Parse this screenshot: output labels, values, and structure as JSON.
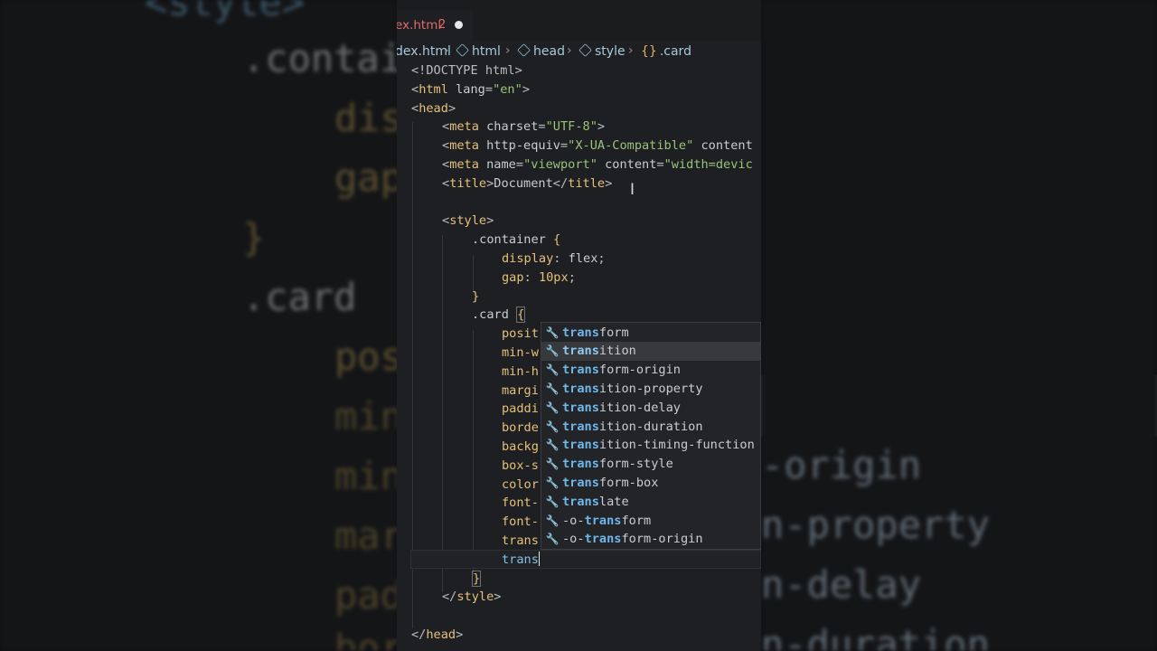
{
  "background": {
    "left_lines": [
      "<style>",
      ".contai",
      "dis",
      "gap",
      "}",
      ".card",
      "pos",
      "min",
      "min",
      "mar",
      "pad",
      "bor"
    ],
    "right_lines": [
      "-origin",
      "n-property",
      "n-delay",
      "n-duration"
    ]
  },
  "tab": {
    "name": "ex.html",
    "problems": "2"
  },
  "breadcrumb": {
    "file": "dex.html",
    "items": [
      "html",
      "head",
      "style",
      ".card"
    ]
  },
  "code": {
    "l1": [
      "<!DOCTYPE html>"
    ],
    "l2_tag": "html",
    "l2_attr": "lang",
    "l2_val": "\"en\"",
    "l3_tag": "head",
    "l4_tag": "meta",
    "l4_attr": "charset",
    "l4_val": "\"UTF-8\"",
    "l5_tag": "meta",
    "l5_attr": "http-equiv",
    "l5_val": "\"X-UA-Compatible\"",
    "l5_rest": "content",
    "l6_tag": "meta",
    "l6_attr": "name",
    "l6_val": "\"viewport\"",
    "l6_attr2": "content",
    "l6_val2": "\"width=devic",
    "l7_tag": "title",
    "l7_text": "Document",
    "l7_endtag": "title",
    "l9_tag": "style",
    "l10_sel": ".container",
    "l11_prop": "display",
    "l11_val": "flex",
    "l12_prop": "gap",
    "l12_val": "10px",
    "l14_sel": ".card",
    "partials": [
      "posit",
      "min-w",
      "min-h",
      "margi",
      "paddi",
      "borde",
      "backg",
      "box-s",
      "color",
      "font-",
      "font-",
      "trans"
    ],
    "typed": "trans",
    "end_style": "style",
    "end_head": "head"
  },
  "suggestions": {
    "items": [
      {
        "match": "trans",
        "rest": "form"
      },
      {
        "match": "trans",
        "rest": "ition",
        "selected": true
      },
      {
        "match": "trans",
        "rest": "form-origin"
      },
      {
        "match": "trans",
        "rest": "ition-property"
      },
      {
        "match": "trans",
        "rest": "ition-delay"
      },
      {
        "match": "trans",
        "rest": "ition-duration"
      },
      {
        "match": "trans",
        "rest": "ition-timing-function"
      },
      {
        "match": "trans",
        "rest": "form-style"
      },
      {
        "match": "trans",
        "rest": "form-box"
      },
      {
        "match": "trans",
        "rest": "late"
      },
      {
        "pre": "-o-",
        "match": "trans",
        "rest": "form"
      },
      {
        "pre": "-o-",
        "match": "trans",
        "rest": "form-origin"
      }
    ]
  }
}
